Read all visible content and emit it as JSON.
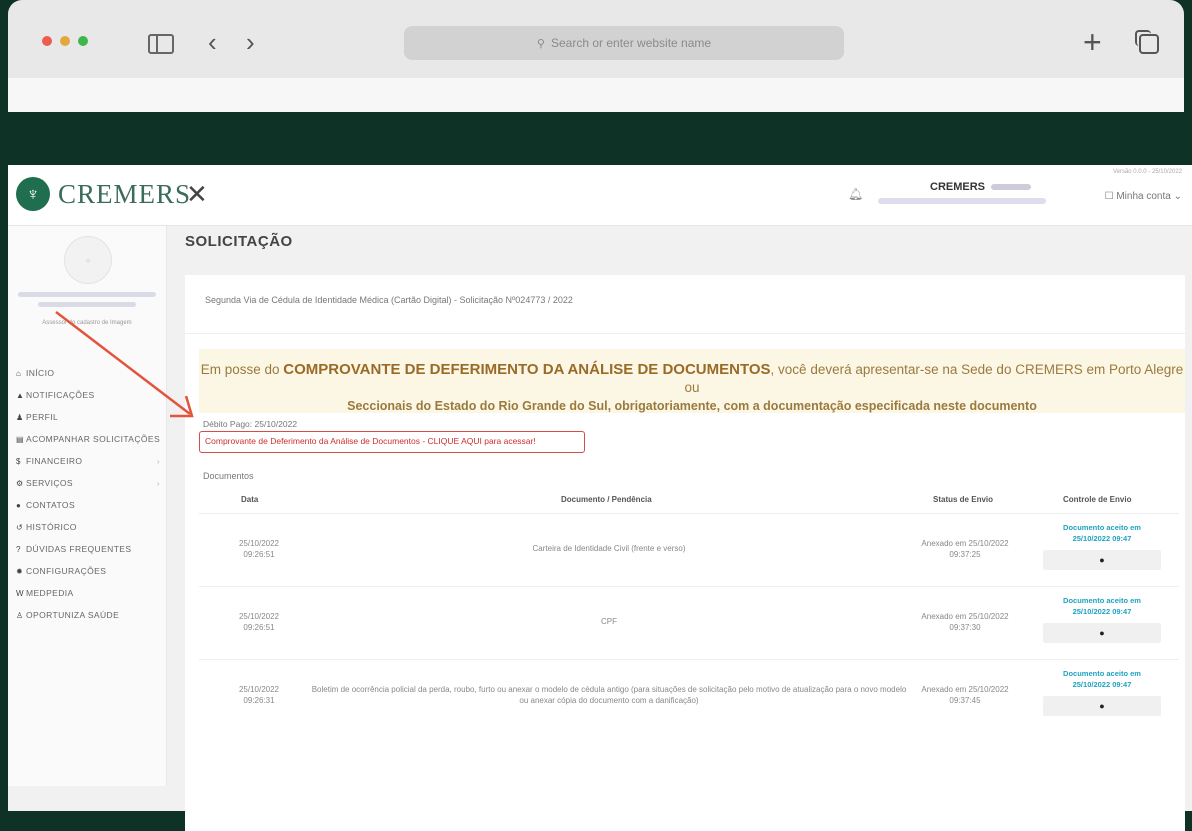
{
  "browser": {
    "address_placeholder": "Search or enter website name"
  },
  "header": {
    "logo": "CREMERS",
    "org_name": "CREMERS",
    "version": "Versão 0.0.0 - 25/10/2022",
    "account": "Minha conta"
  },
  "sidebar": {
    "role": "Assessor do cadastro de Imagem",
    "items": [
      {
        "label": "INÍCIO",
        "icon": "home-icon"
      },
      {
        "label": "NOTIFICAÇÕES",
        "icon": "bell-icon"
      },
      {
        "label": "PERFIL",
        "icon": "user-icon"
      },
      {
        "label": "ACOMPANHAR SOLICITAÇÕES",
        "icon": "doc-icon"
      },
      {
        "label": "FINANCEIRO",
        "icon": "dollar-icon"
      },
      {
        "label": "SERVIÇOS",
        "icon": "gears-icon"
      },
      {
        "label": "CONTATOS",
        "icon": "chat-icon"
      },
      {
        "label": "HISTÓRICO",
        "icon": "history-icon"
      },
      {
        "label": "DÚVIDAS FREQUENTES",
        "icon": "question-icon"
      },
      {
        "label": "CONFIGURAÇÕES",
        "icon": "gear-icon"
      },
      {
        "label": "MEDPEDIA",
        "icon": "wiki-icon"
      },
      {
        "label": "OPORTUNIZA SAÚDE",
        "icon": "building-icon"
      }
    ]
  },
  "main": {
    "title": "SOLICITAÇÃO",
    "request": "Segunda Via de Cédula de Identidade Médica (Cartão Digital) - Solicitação Nº024773 / 2022",
    "banner_pre": "Em posse do ",
    "banner_bold": "COMPROVANTE DE DEFERIMENTO DA ANÁLISE DE DOCUMENTOS",
    "banner_post": ", você deverá apresentar-se na Sede do CREMERS em Porto Alegre ou",
    "banner_line2": "Seccionais do Estado do Rio Grande do Sul, obrigatoriamente, com a documentação especificada neste documento",
    "debit": "Débito Pago: 25/10/2022",
    "link": "Comprovante de Deferimento da Análise de Documentos - CLIQUE AQUI para acessar!",
    "docs_label": "Documentos",
    "columns": [
      "Data",
      "Documento / Pendência",
      "Status de Envio",
      "Controle de Envio"
    ],
    "rows": [
      {
        "date": "25/10/2022",
        "time": "09:26:51",
        "doc": "Carteira de Identidade Civil (frente e verso)",
        "status": "Anexado em 25/10/2022",
        "status_time": "09:37:25",
        "control": "Documento aceito em",
        "control_date": "25/10/2022 09:47",
        "btn": "●"
      },
      {
        "date": "25/10/2022",
        "time": "09:26:51",
        "doc": "CPF",
        "status": "Anexado em 25/10/2022",
        "status_time": "09:37:30",
        "control": "Documento aceito em",
        "control_date": "25/10/2022 09:47",
        "btn": "●"
      },
      {
        "date": "25/10/2022",
        "time": "09:26:31",
        "doc": "Boletim de ocorrência policial da perda, roubo, furto ou anexar o modelo de cédula antigo (para situações de solicitação pelo motivo de atualização para o novo modelo ou anexar cópia do documento com a danificação)",
        "status": "Anexado em 25/10/2022",
        "status_time": "09:37:45",
        "control": "Documento aceito em",
        "control_date": "25/10/2022 09:47",
        "btn": "●"
      }
    ]
  },
  "colors": {
    "background": "#0e3326",
    "brand_green": "#1f6e4f",
    "banner_bg": "#fcf7e4",
    "highlight_red": "#d64b4b",
    "accepted_blue": "#20a2c0"
  }
}
